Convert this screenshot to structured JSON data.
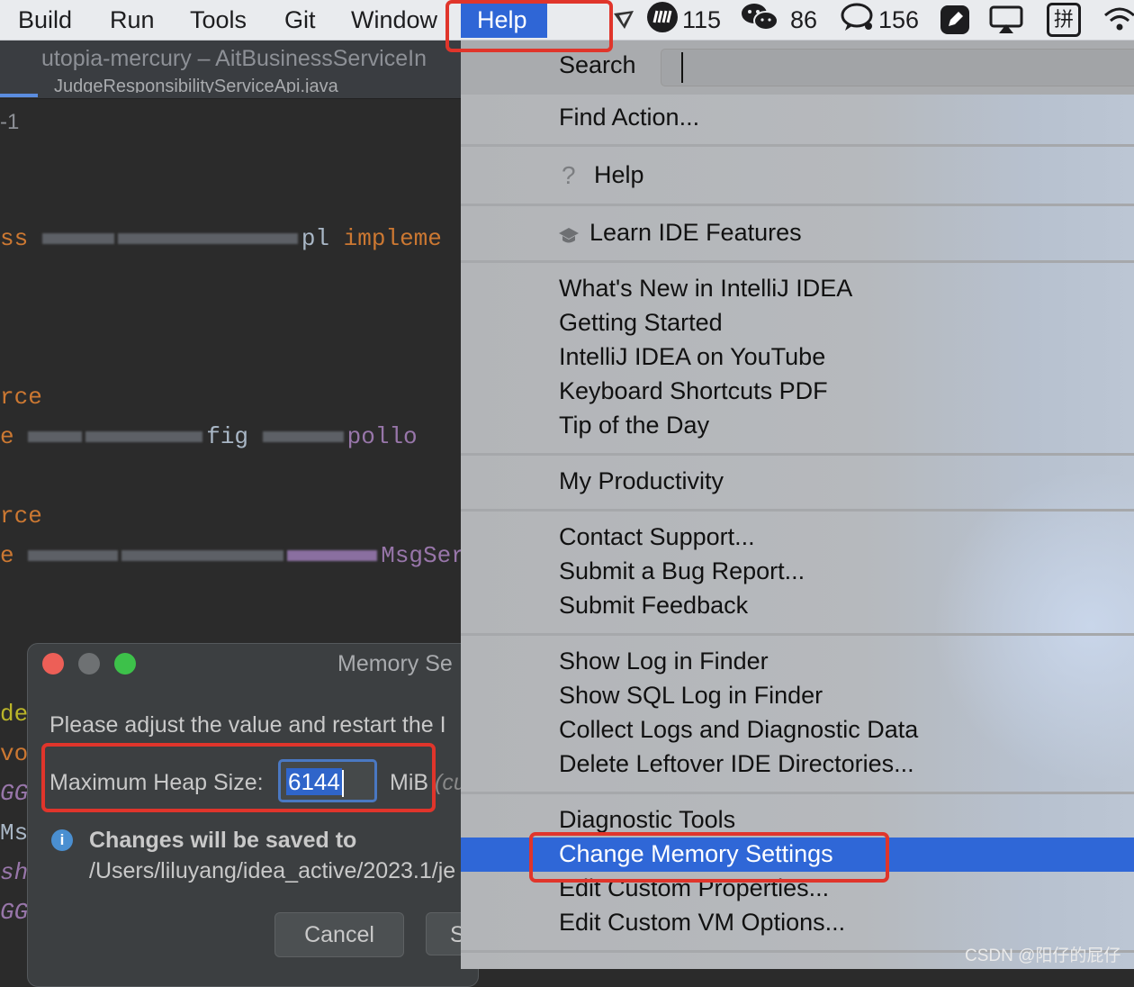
{
  "menubar": {
    "items": [
      "Build",
      "Run",
      "Tools",
      "Git",
      "Window",
      "Help"
    ],
    "status": {
      "app1_count": "115",
      "wechat_count": "86",
      "chat_count": "156",
      "input_method": "拼"
    }
  },
  "editor": {
    "window_title": "utopia-mercury – AitBusinessServiceIn",
    "tab_label": "JudgeResponsibilityServiceApi.java",
    "line_fragment": "-1",
    "code": {
      "l1_kw": "ss",
      "l1_text": "pl",
      "l1_kw2": "impleme",
      "l2_kw": "rce",
      "l3_kw": "e",
      "l3_text": "fig",
      "l3_pu": "pollo",
      "l4_kw": "rce",
      "l5_kw": "e",
      "l5_pu": "MsgSer",
      "l6_an": "de",
      "l7_kw": "vo",
      "l8_an": "GGL",
      "l9_text": "Ms",
      "l10_an": "sh",
      "l11_an": "GGL"
    }
  },
  "dialog": {
    "title": "Memory Se",
    "message": "Please adjust the value and restart the I",
    "heap_label": "Maximum Heap Size:",
    "heap_value": "6144",
    "heap_unit": "MiB",
    "heap_note": "(cu",
    "saved_title": "Changes will be saved to",
    "saved_path": "/Users/liluyang/idea_active/2023.1/je",
    "cancel_label": "Cancel",
    "save_label": "S"
  },
  "help_menu": {
    "search_label": "Search",
    "find_action": "Find Action...",
    "help": "Help",
    "learn": "Learn IDE Features",
    "whats_new": "What's New in IntelliJ IDEA",
    "getting_started": "Getting Started",
    "youtube": "IntelliJ IDEA on YouTube",
    "shortcuts_pdf": "Keyboard Shortcuts PDF",
    "tip": "Tip of the Day",
    "productivity": "My Productivity",
    "contact": "Contact Support...",
    "bug": "Submit a Bug Report...",
    "feedback": "Submit Feedback",
    "show_log": "Show Log in Finder",
    "show_sql_log": "Show SQL Log in Finder",
    "collect_logs": "Collect Logs and Diagnostic Data",
    "delete_dirs": "Delete Leftover IDE Directories...",
    "diagnostic": "Diagnostic Tools",
    "change_memory": "Change Memory Settings",
    "custom_props": "Edit Custom Properties...",
    "custom_vm": "Edit Custom VM Options..."
  },
  "watermark": "CSDN @阳仔的屁仔",
  "colors": {
    "accent": "#2f67d7",
    "annotation_red": "#e0352b"
  }
}
